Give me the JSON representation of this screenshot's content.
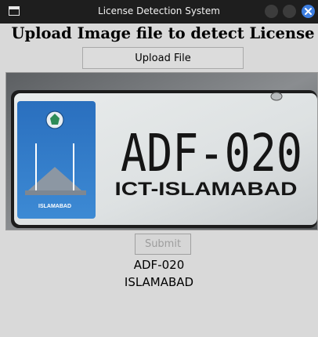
{
  "window": {
    "title": "License Detection System",
    "icon": "window-app-icon",
    "controls": [
      "minimize-icon",
      "maximize-icon",
      "close-icon"
    ]
  },
  "main": {
    "heading": "Upload Image file to detect License",
    "upload_label": "Upload File",
    "submit_label": "Submit",
    "submit_enabled": false,
    "result_plate": "ADF-020",
    "result_city": "ISLAMABAD"
  },
  "preview": {
    "plate_number": "ADF-020",
    "plate_region": "ICT-ISLAMABAD",
    "emblem_caption": "ISLAMABAD"
  },
  "colors": {
    "titlebar": "#1e1e1e",
    "window_bg": "#d9d9d9",
    "close_button": "#3d7ee0",
    "plate_blue": "#2f78c4"
  }
}
